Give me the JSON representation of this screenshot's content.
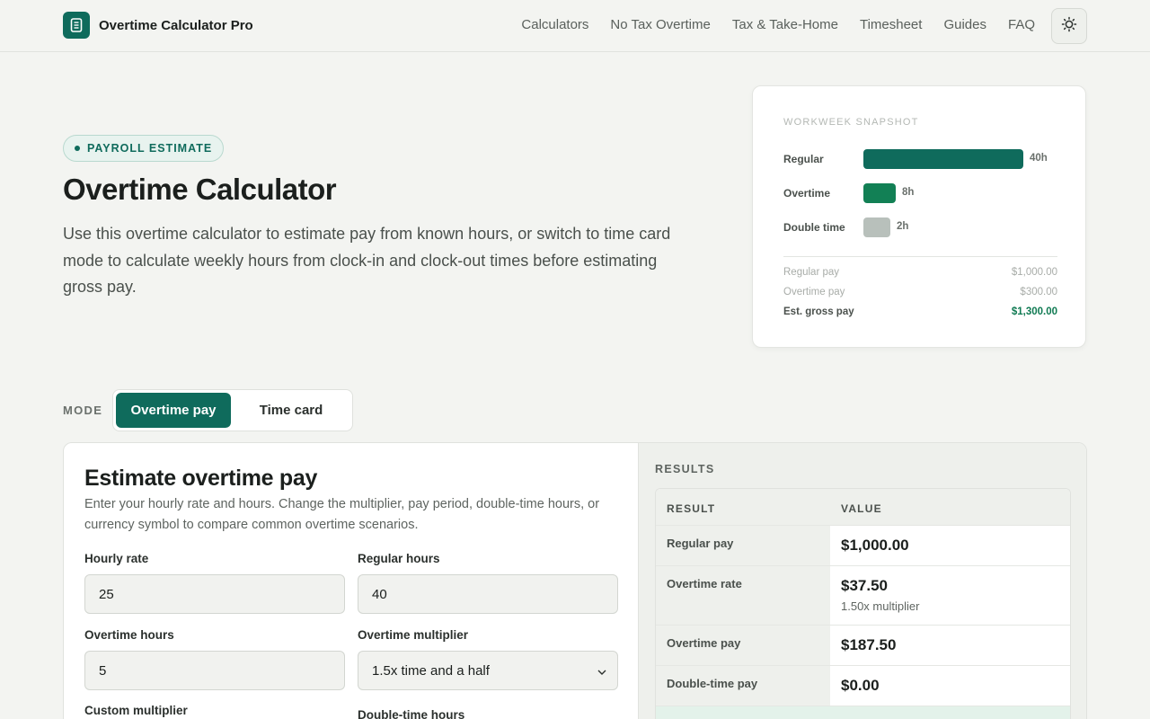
{
  "header": {
    "brand": "Overtime Calculator Pro",
    "nav": [
      "Calculators",
      "No Tax Overtime",
      "Tax & Take-Home",
      "Timesheet",
      "Guides",
      "FAQ"
    ]
  },
  "hero": {
    "badge": "PAYROLL ESTIMATE",
    "title": "Overtime Calculator",
    "description": "Use this overtime calculator to estimate pay from known hours, or switch to time card mode to calculate weekly hours from clock-in and clock-out times before estimating gross pay."
  },
  "snapshot": {
    "title": "WORKWEEK SNAPSHOT",
    "rows": [
      {
        "label": "Regular",
        "value": "40h",
        "hours": 40,
        "color": "#0f6b5c"
      },
      {
        "label": "Overtime",
        "value": "8h",
        "hours": 8,
        "color": "#128055"
      },
      {
        "label": "Double time",
        "value": "2h",
        "hours": 2,
        "color": "#b8c0bb"
      }
    ],
    "summary": [
      {
        "label": "Regular pay",
        "value": "$1,000.00"
      },
      {
        "label": "Overtime pay",
        "value": "$300.00"
      },
      {
        "label": "Est. gross pay",
        "value": "$1,300.00"
      }
    ]
  },
  "mode": {
    "label": "MODE",
    "options": [
      "Overtime pay",
      "Time card"
    ],
    "selected": "Overtime pay"
  },
  "form": {
    "title": "Estimate overtime pay",
    "description": "Enter your hourly rate and hours. Change the multiplier, pay period, double-time hours, or currency symbol to compare common overtime scenarios.",
    "fields": {
      "hourly_rate": {
        "label": "Hourly rate",
        "value": "25"
      },
      "regular_hours": {
        "label": "Regular hours",
        "value": "40"
      },
      "overtime_hours": {
        "label": "Overtime hours",
        "value": "5"
      },
      "overtime_multiplier": {
        "label": "Overtime multiplier",
        "value": "1.5x time and a half"
      },
      "custom_multiplier": {
        "label": "Custom multiplier"
      },
      "double_time_hours": {
        "label": "Double-time hours"
      }
    }
  },
  "results": {
    "title": "RESULTS",
    "columns": [
      "RESULT",
      "VALUE"
    ],
    "rows": [
      {
        "label": "Regular pay",
        "value": "$1,000.00",
        "sub": ""
      },
      {
        "label": "Overtime rate",
        "value": "$37.50",
        "sub": "1.50x multiplier"
      },
      {
        "label": "Overtime pay",
        "value": "$187.50",
        "sub": ""
      },
      {
        "label": "Double-time pay",
        "value": "$0.00",
        "sub": ""
      }
    ]
  },
  "colors": {
    "accent": "#0f6b5c",
    "total": "#0f7a52"
  }
}
